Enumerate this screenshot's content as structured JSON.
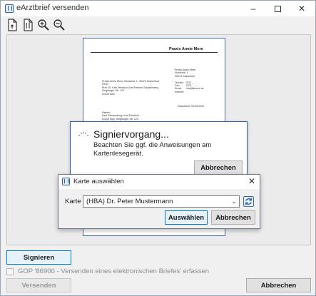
{
  "window": {
    "title": "eArztbrief versenden",
    "controls": {
      "minimize": "–",
      "close": "✕"
    }
  },
  "toolbar": {
    "icons": [
      "export-document-icon",
      "import-document-icon",
      "zoom-in-icon",
      "zoom-out-icon"
    ]
  },
  "document": {
    "header": "Praxis Annie More",
    "lines_left": "Praxis Annie More, Musterstr. 1, 45474 Düsseldorf\nHerrn\nProf. Dr. Karl-Friedrich Graf Freiherr Schaumberg\nSiegburger Str. 123\n51105 Köln",
    "lines_right": "Praxis Annie More\nMusterstr. 1\n45474 Düsseldorf\n\nTelefon:   0211 - ......\nFax:         0211 - .......\nEmail:      info@amore.de\nInternet:",
    "date_line": "Düsseldorf, 02.05.2022",
    "patient_lines": "Patient:\nHerr Schaumberg, Karl-Friedrich\n51105 Köln, Siegburger Str. 123\n01.01.1960"
  },
  "signing_dialog": {
    "title": "Signiervorgang...",
    "message": "Beachten Sie ggf. die Anweisungen am Kartenlesegerät.",
    "cancel_label": "Abbrechen"
  },
  "card_dialog": {
    "title": "Karte auswählen",
    "close": "✕",
    "field_label": "Karte",
    "selected_value": "(HBA) Dr. Peter Mustermann",
    "select_label": "Auswählen",
    "cancel_label": "Abbrechen"
  },
  "footer": {
    "sign_label": "Signieren",
    "checkbox_label": "GOP '86900 - Versenden eines elektronischen Briefes' erfassen",
    "send_label": "Versenden",
    "cancel_label": "Abbrechen"
  },
  "colors": {
    "accent": "#0078d7",
    "dialog_border": "#2f5fae"
  }
}
